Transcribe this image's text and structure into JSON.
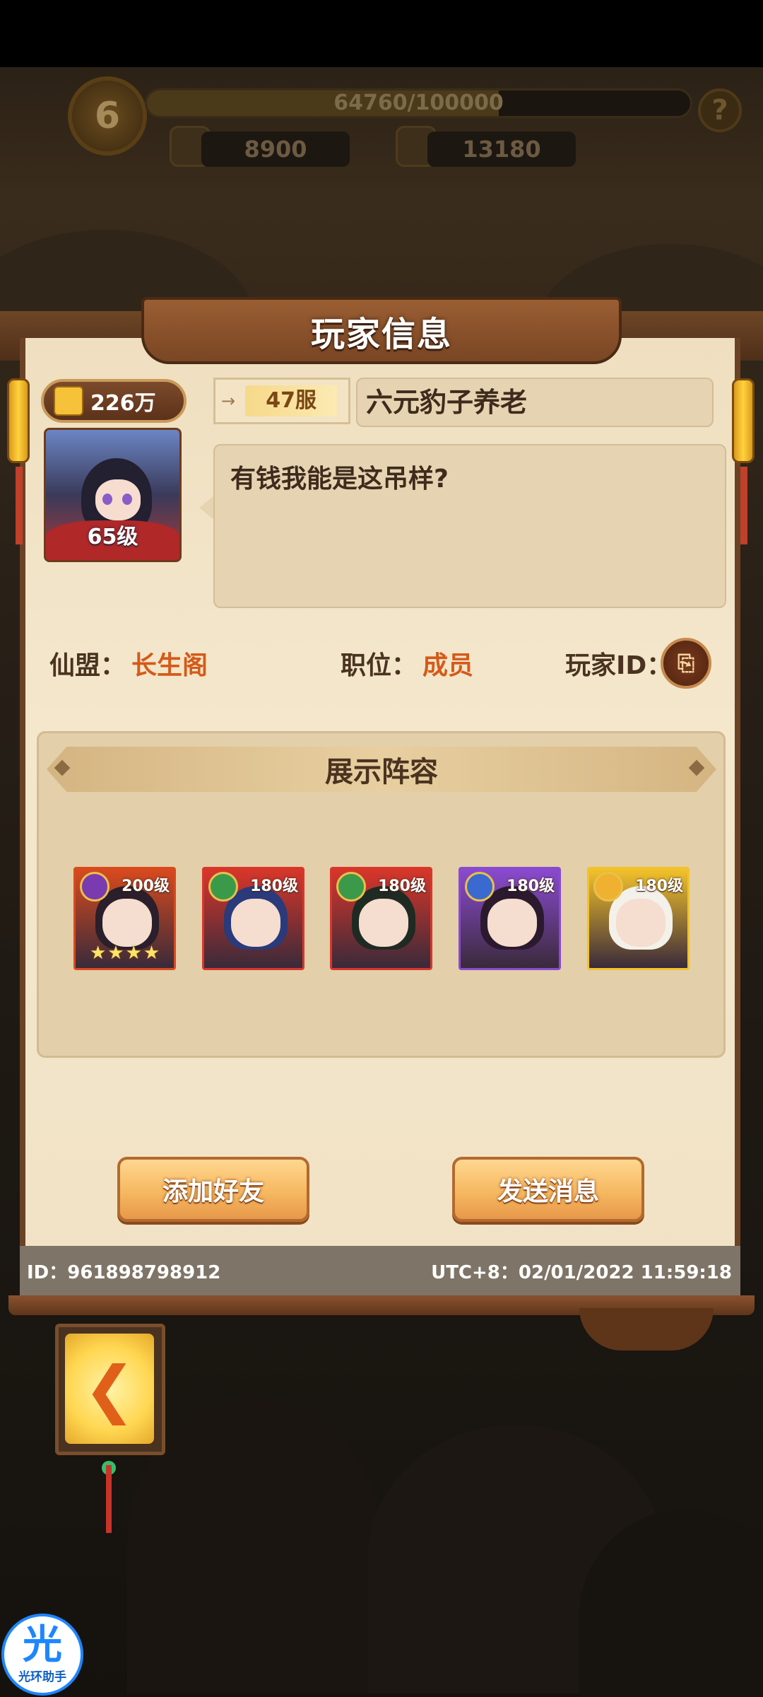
{
  "hud": {
    "level": "6",
    "exp_text": "64760/100000",
    "exp_progress": 0.6476,
    "help": "?",
    "resource1": "8900",
    "resource2": "13180"
  },
  "dialog": {
    "title": "玩家信息",
    "power": "226万",
    "server": "47服",
    "player_name": "六元豹子养老",
    "avatar_level": "65级",
    "signature": "有钱我能是这吊样?",
    "alliance_label": "仙盟：",
    "alliance_value": "长生阁",
    "position_label": "职位：",
    "position_value": "成员",
    "player_id_label": "玩家ID：",
    "lineup_title": "展示阵容",
    "heroes": [
      {
        "level": "200级",
        "frame_color": "#d84a1e",
        "stars": "★★★★"
      },
      {
        "level": "180级",
        "frame_color": "#d8362a",
        "stars": ""
      },
      {
        "level": "180级",
        "frame_color": "#d8362a",
        "stars": ""
      },
      {
        "level": "180级",
        "frame_color": "#8a4ad0",
        "stars": ""
      },
      {
        "level": "180级",
        "frame_color": "#f3c22a",
        "stars": ""
      }
    ],
    "add_friend_label": "添加好友",
    "send_message_label": "发送消息",
    "footer_id": "ID：961898798912",
    "footer_time": "UTC+8：02/01/2022 11:59:18"
  },
  "assistant": {
    "glyph": "光",
    "label": "光环助手"
  },
  "colors": {
    "accent_orange": "#d45a1a",
    "button_gold": "#f6b860",
    "panel_bg": "#f1e2c5"
  }
}
